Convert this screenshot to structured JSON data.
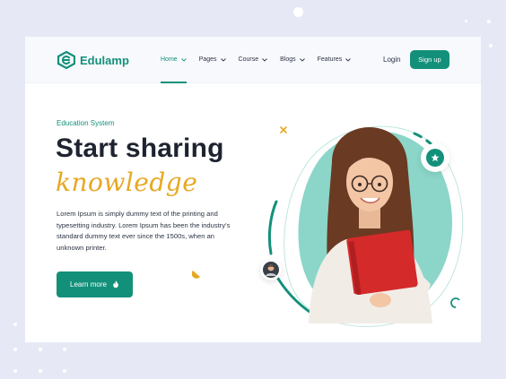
{
  "brand": {
    "name": "Edulamp",
    "accent": "#13907a",
    "secondary": "#e6a823"
  },
  "nav": {
    "items": [
      {
        "label": "Home",
        "active": true
      },
      {
        "label": "Pages",
        "active": false
      },
      {
        "label": "Course",
        "active": false
      },
      {
        "label": "Blogs",
        "active": false
      },
      {
        "label": "Features",
        "active": false
      }
    ],
    "login_label": "Login",
    "signup_label": "Sign up"
  },
  "hero": {
    "eyebrow": "Education System",
    "title": "Start sharing",
    "script": "knowledge",
    "paragraph": "Lorem Ipsum is simply dummy text of the printing and typesetting industry. Lorem Ipsum has been the industry's standard dummy text ever since the 1500s, when an unknown printer.",
    "cta_label": "Learn more",
    "cta_icon": "flame-icon"
  },
  "badges": {
    "star_icon": "star-icon",
    "avatar_icon": "user-avatar"
  }
}
